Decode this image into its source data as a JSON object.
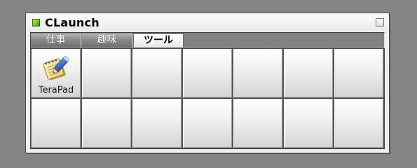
{
  "window": {
    "title": "CLaunch",
    "app_icon": "green-square-icon",
    "maximize_icon": "maximize-icon"
  },
  "tabs": [
    {
      "label": "仕事",
      "active": false
    },
    {
      "label": "趣味",
      "active": false
    },
    {
      "label": "ツール",
      "active": true
    }
  ],
  "grid": {
    "rows": 2,
    "columns": 7,
    "items": [
      {
        "label": "TeraPad",
        "icon": "notepad-pen-icon"
      }
    ]
  }
}
